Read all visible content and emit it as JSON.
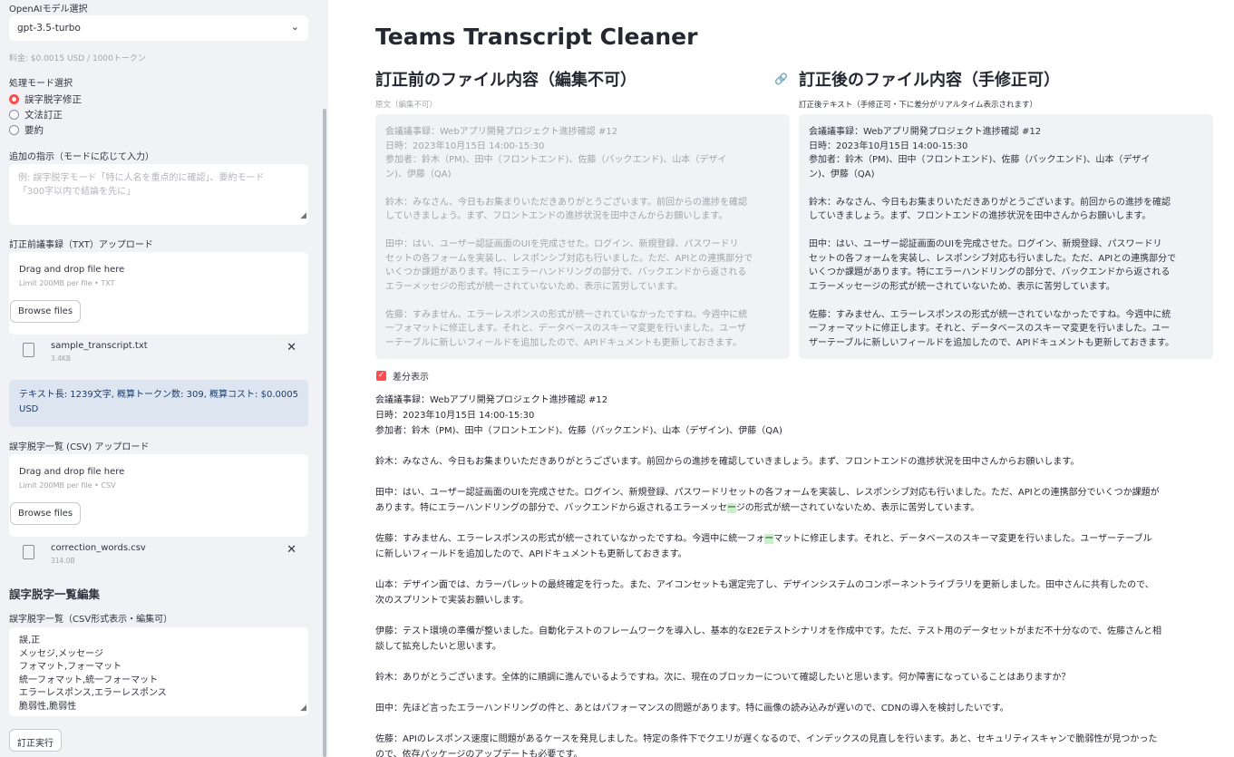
{
  "sidebar": {
    "model_label": "OpenAIモデル選択",
    "model_value": "gpt-3.5-turbo",
    "price_caption": "料金: $0.0015 USD / 1000トークン",
    "mode_label": "処理モード選択",
    "modes": [
      "誤字脱字修正",
      "文法訂正",
      "要約"
    ],
    "instruction_label": "追加の指示（モードに応じて入力）",
    "instruction_placeholder_1": "例: 誤字脱字モード「特に人名を重点的に確認」、要約モード",
    "instruction_placeholder_2": "「300字以内で結論を先に」",
    "upload1_label": "訂正前議事録（TXT）アップロード",
    "upload1_title": "Drag and drop file here",
    "upload1_limit": "Limit 200MB per file • TXT",
    "browse_label": "Browse files",
    "file1_name": "sample_transcript.txt",
    "file1_size": "3.4KB",
    "info_text": "テキスト長: 1239文字, 概算トークン数: 309, 概算コスト: $0.0005 USD",
    "upload2_label": "誤字脱字一覧 (CSV) アップロード",
    "upload2_title": "Drag and drop file here",
    "upload2_limit": "Limit 200MB per file • CSV",
    "file2_name": "correction_words.csv",
    "file2_size": "314.0B",
    "edit_heading": "誤字脱字一覧編集",
    "csv_label": "誤字脱字一覧（CSV形式表示・編集可）",
    "csv_lines": [
      "誤,正",
      "メッセジ,メッセージ",
      "フォマット,フォーマット",
      "統一フォマット,統一フォーマット",
      "エラーレスポンス,エラーレスポンス",
      "脆弱性,脆弱性"
    ],
    "run_button": "訂正実行"
  },
  "main": {
    "title": "Teams Transcript Cleaner",
    "before_heading": "訂正前のファイル内容（編集不可）",
    "after_heading": "訂正後のファイル内容（手修正可）",
    "before_label": "原文（編集不可）",
    "after_label": "訂正後テキスト（手修正可・下に差分がリアルタイム表示されます）",
    "before_lines": [
      "会議議事録：Webアプリ開発プロジェクト進捗確認 #12",
      "日時：2023年10月15日 14:00-15:30",
      "参加者：鈴木（PM)、田中（フロントエンド)、佐藤（バックエンド)、山本（デザイ",
      "ン)、伊藤（QA)",
      "",
      "鈴木：みなさん、今日もお集まりいただきありがとうございます。前回からの進捗を確認",
      "していきましょう。まず、フロントエンドの進捗状況を田中さんからお願いします。",
      "",
      "田中：はい、ユーザー認証画面のUIを完成させた。ログイン、新規登録、パスワードリ",
      "セットの各フォームを実装し、レスポンシブ対応も行いました。ただ、APIとの連携部分で",
      "いくつか課題があります。特にエラーハンドリングの部分で、バックエンドから返される",
      "エラーメッセジの形式が統一されていないため、表示に苦労しています。",
      "",
      "佐藤：すみません、エラーレスポンスの形式が統一されていなかったですね。今週中に統",
      "一フォマットに修正します。それと、データベースのスキーマ変更を行いました。ユーザ",
      "ーテーブルに新しいフィールドを追加したので、APIドキュメントも更新しておきます。"
    ],
    "after_lines": [
      "会議議事録：Webアプリ開発プロジェクト進捗確認 #12",
      "日時：2023年10月15日 14:00-15:30",
      "参加者：鈴木（PM)、田中（フロントエンド)、佐藤（バックエンド)、山本（デザイ",
      "ン)、伊藤（QA)",
      "",
      "鈴木：みなさん、今日もお集まりいただきありがとうございます。前回からの進捗を確認",
      "していきましょう。まず、フロントエンドの進捗状況を田中さんからお願いします。",
      "",
      "田中：はい、ユーザー認証画面のUIを完成させた。ログイン、新規登録、パスワードリ",
      "セットの各フォームを実装し、レスポンシブ対応も行いました。ただ、APIとの連携部分で",
      "いくつか課題があります。特にエラーハンドリングの部分で、バックエンドから返される",
      "エラーメッセージの形式が統一されていないため、表示に苦労しています。",
      "",
      "佐藤：すみません、エラーレスポンスの形式が統一されていなかったですね。今週中に統",
      "一フォーマットに修正します。それと、データベースのスキーマ変更を行いました。ユー",
      "ザーテーブルに新しいフィールドを追加したので、APIドキュメントも更新しておきます。"
    ],
    "diff_checkbox": "差分表示",
    "diff": {
      "l1": "会議議事録：Webアプリ開発プロジェクト進捗確認 #12",
      "l2": "日時：2023年10月15日 14:00-15:30",
      "l3": "参加者：鈴木（PM)、田中（フロントエンド)、佐藤（バックエンド)、山本（デザイン)、伊藤（QA)",
      "l4": "鈴木：みなさん、今日もお集まりいただきありがとうございます。前回からの進捗を確認していきましょう。まず、フロントエンドの進捗状況を田中さんからお願いします。",
      "l5": "田中：はい、ユーザー認証画面のUIを完成させた。ログイン、新規登録、パスワードリセットの各フォームを実装し、レスポンシブ対応も行いました。ただ、APIとの連携部分でいくつか課題が",
      "l6a": "あります。特にエラーハンドリングの部分で、バックエンドから返されるエラーメッセ",
      "l6hl": "ー",
      "l6b": "ジの形式が統一されていないため、表示に苦労しています。",
      "l7a": "佐藤：すみません、エラーレスポンスの形式が統一されていなかったですね。今週中に統一フォ",
      "l7hl": "ー",
      "l7b": "マットに修正します。それと、データベースのスキーマ変更を行いました。ユーザーテーブル",
      "l8": "に新しいフィールドを追加したので、APIドキュメントも更新しておきます。",
      "l9": "山本：デザイン面では、カラーパレットの最終確定を行った。また、アイコンセットも選定完了し、デザインシステムのコンポーネントライブラリを更新しました。田中さんに共有したので、",
      "l10": "次のスプリントで実装お願いします。",
      "l11": "伊藤：テスト環境の準備が整いました。自動化テストのフレームワークを導入し、基本的なE2Eテストシナリオを作成中です。ただ、テスト用のデータセットがまだ不十分なので、佐藤さんと相",
      "l12": "談して拡充したいと思います。",
      "l13": "鈴木：ありがとうございます。全体的に順調に進んでいるようですね。次に、現在のブロッカーについて確認したいと思います。何か障害になっていることはありますか？",
      "l14": "田中：先ほど言ったエラーハンドリングの件と、あとはパフォーマンスの問題があります。特に画像の読み込みが遅いので、CDNの導入を検討したいです。",
      "l15": "佐藤：APIのレスポンス速度に問題があるケースを発見しました。特定の条件下でクエリが遅くなるので、インデックスの見直しを行います。あと、セキュリティスキャンで脆弱性が見つかった",
      "l16": "ので、依存パッケージのアップデートも必要です。"
    }
  }
}
